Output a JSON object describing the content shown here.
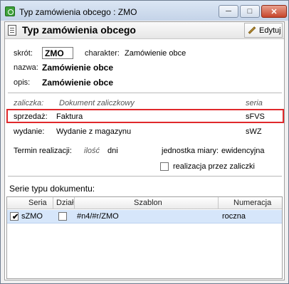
{
  "window": {
    "title": "Typ zamówienia obcego : ZMO",
    "min_glyph": "─",
    "max_glyph": "□",
    "close_glyph": "✕"
  },
  "header": {
    "title": "Typ zamówienia obcego",
    "edit_label": "Edytuj"
  },
  "fields": {
    "skrot_label": "skrót:",
    "skrot_value": "ZMO",
    "charakter_label": "charakter:",
    "charakter_value": "Zamówienie obce",
    "nazwa_label": "nazwa:",
    "nazwa_value": "Zamówienie obce",
    "opis_label": "opis:",
    "opis_value": "Zamówienie obce"
  },
  "documents": {
    "zaliczka_label": "zaliczka:",
    "zaliczka_value": "Dokument zaliczkowy",
    "zaliczka_series": "seria",
    "sprzedaz_label": "sprzedaż:",
    "sprzedaz_value": "Faktura",
    "sprzedaz_series": "sFVS",
    "wydanie_label": "wydanie:",
    "wydanie_value": "Wydanie z magazynu",
    "wydanie_series": "sWZ"
  },
  "realizacja": {
    "termin_label": "Termin realizacji:",
    "ilosc": "ilość",
    "unit": "dni",
    "jednostka_label": "jednostka miary:",
    "jednostka_value": "ewidencyjna",
    "zaliczki_label": "realizacja przez zaliczki",
    "zaliczki_checked": false
  },
  "series": {
    "section_title": "Serie typu dokumentu:",
    "columns": [
      "Seria",
      "Dział",
      "Szablon",
      "Numeracja"
    ],
    "rows": [
      {
        "checked": true,
        "seria": "sZMO",
        "dzial_checked": false,
        "szablon": "#n4/#r/ZMO",
        "numeracja": "roczna"
      }
    ]
  },
  "colors": {
    "highlight_border": "#e0292b",
    "selected_row": "#d6e6fa"
  }
}
